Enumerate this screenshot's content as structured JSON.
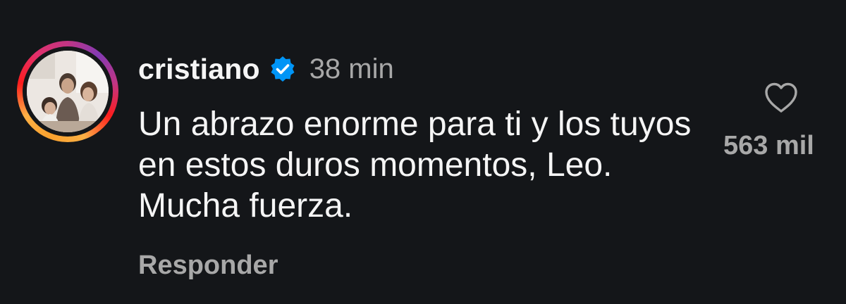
{
  "comment": {
    "username": "cristiano",
    "verified_icon": "verified-badge-icon",
    "time": "38 min",
    "text": "Un abrazo enorme para ti y los tuyos en estos duros momentos, Leo. Mucha fuerza.",
    "reply_label": "Responder",
    "like_icon": "heart-outline-icon",
    "like_count": "563 mil"
  },
  "colors": {
    "background": "#141619",
    "primary_text": "#f5f5f5",
    "secondary_text": "#a8a8a8",
    "verified_blue": "#0095f6"
  }
}
